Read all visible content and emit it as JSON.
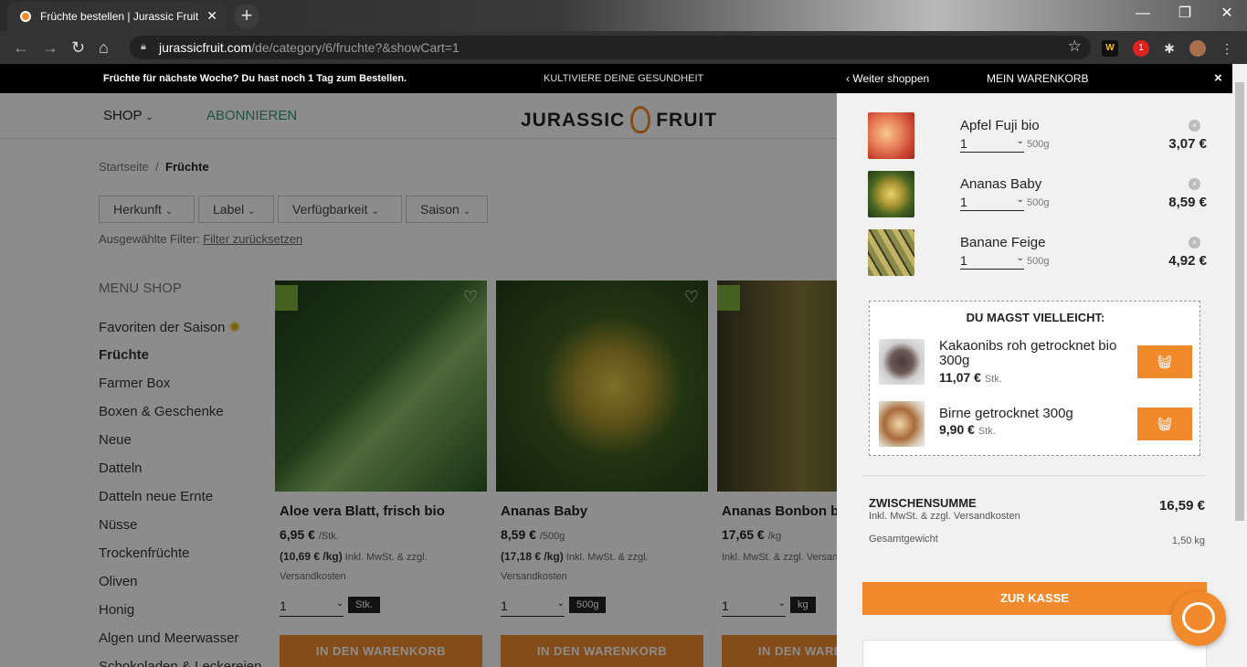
{
  "browser": {
    "tab_title": "Früchte bestellen | Jurassic Fruit",
    "url_host": "jurassicfruit.com",
    "url_path": "/de/category/6/fruchte?&showCart=1",
    "ext_badge": "1"
  },
  "site": {
    "promo_left": "Früchte für nächste Woche? Du hast noch 1 Tag zum Bestellen.",
    "promo_center": "KULTIVIERE DEINE GESUNDHEIT",
    "nav_shop": "SHOP",
    "nav_abo": "ABONNIEREN",
    "logo_left": "JURASSIC",
    "logo_right": "FRUIT",
    "crumb_home": "Startseite",
    "crumb_sep": "/",
    "crumb_current": "Früchte",
    "filters": [
      "Herkunft",
      "Label",
      "Verfügbarkeit",
      "Saison"
    ],
    "selected_label": "Ausgewählte Filter:",
    "reset_label": "Filter zurücksetzen",
    "menu_heading": "MENU SHOP",
    "menu": [
      "Favoriten der Saison",
      "Früchte",
      "Farmer Box",
      "Boxen & Geschenke",
      "Neue",
      "Datteln",
      "Datteln neue Ernte",
      "Nüsse",
      "Trockenfrüchte",
      "Oliven",
      "Honig",
      "Algen und Meerwasser",
      "Schokoladen & Leckereien"
    ],
    "products": [
      {
        "name": "Aloe vera Blatt, frisch bio",
        "price": "6,95 €",
        "per": "/Stk.",
        "ppk": "(10,69 € /kg)",
        "tax": "Inkl. MwSt. & zzgl. Versandkosten",
        "qty": "1",
        "unit": "Stk.",
        "btn": "IN DEN WARENKORB"
      },
      {
        "name": "Ananas Baby",
        "price": "8,59 €",
        "per": "/500g",
        "ppk": "(17,18 € /kg)",
        "tax": "Inkl. MwSt. & zzgl. Versandkosten",
        "qty": "1",
        "unit": "500g",
        "btn": "IN DEN WARENKORB"
      },
      {
        "name": "Ananas Bonbon bio",
        "price": "17,65 €",
        "per": "/kg",
        "ppk": "",
        "tax": "Inkl. MwSt. & zzgl. Versandkosten",
        "qty": "1",
        "unit": "kg",
        "btn": "IN DEN WARENKORB"
      }
    ]
  },
  "cart": {
    "back": "Weiter shoppen",
    "title": "MEIN WARENKORB",
    "close": "×",
    "items": [
      {
        "name": "Apfel Fuji bio",
        "qty": "1",
        "weight": "500g",
        "price": "3,07 €"
      },
      {
        "name": "Ananas Baby",
        "qty": "1",
        "weight": "500g",
        "price": "8,59 €"
      },
      {
        "name": "Banane Feige",
        "qty": "1",
        "weight": "500g",
        "price": "4,92 €"
      }
    ],
    "suggest_title": "DU MAGST VIELLEICHT:",
    "suggestions": [
      {
        "name": "Kakaonibs roh getrocknet bio 300g",
        "price": "11,07 €",
        "unit": "Stk."
      },
      {
        "name": "Birne getrocknet 300g",
        "price": "9,90 €",
        "unit": "Stk."
      }
    ],
    "subtotal_label": "ZWISCHENSUMME",
    "subtotal": "16,59 €",
    "incl": "Inkl. MwSt. & zzgl. Versandkosten",
    "weight_label": "Gesamtgewicht",
    "weight": "1,50 kg",
    "checkout": "ZUR KASSE"
  }
}
